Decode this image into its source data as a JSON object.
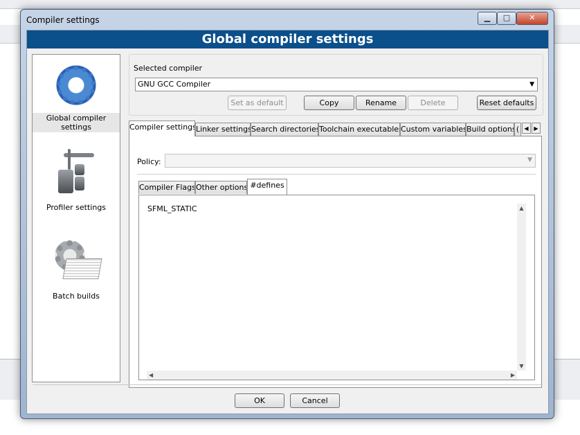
{
  "window": {
    "title": "Compiler settings",
    "header": "Global compiler settings",
    "controls": {
      "minimize": "▁",
      "maximize": "□",
      "close": "✕"
    }
  },
  "sidebar": {
    "items": [
      {
        "label": "Global compiler settings",
        "icon": "gear-icon",
        "selected": true
      },
      {
        "label": "Profiler settings",
        "icon": "profiler-icon",
        "selected": false
      },
      {
        "label": "Batch builds",
        "icon": "batch-builds-icon",
        "selected": false
      }
    ]
  },
  "compiler_select": {
    "group_label": "Selected compiler",
    "value": "GNU GCC Compiler"
  },
  "actions": {
    "set_as_default": "Set as default",
    "copy": "Copy",
    "rename": "Rename",
    "delete": "Delete",
    "reset_defaults": "Reset defaults"
  },
  "tabs": {
    "items": [
      "Compiler settings",
      "Linker settings",
      "Search directories",
      "Toolchain executables",
      "Custom variables",
      "Build options",
      "("
    ],
    "active": "Compiler settings"
  },
  "policy": {
    "label": "Policy:",
    "value": ""
  },
  "inner_tabs": {
    "items": [
      "Compiler Flags",
      "Other options",
      "#defines"
    ],
    "active": "#defines"
  },
  "defines_text": "SFML_STATIC",
  "footer": {
    "ok": "OK",
    "cancel": "Cancel"
  },
  "colors": {
    "header_bg": "#0b4f8b",
    "accent": "#3b78c9"
  }
}
